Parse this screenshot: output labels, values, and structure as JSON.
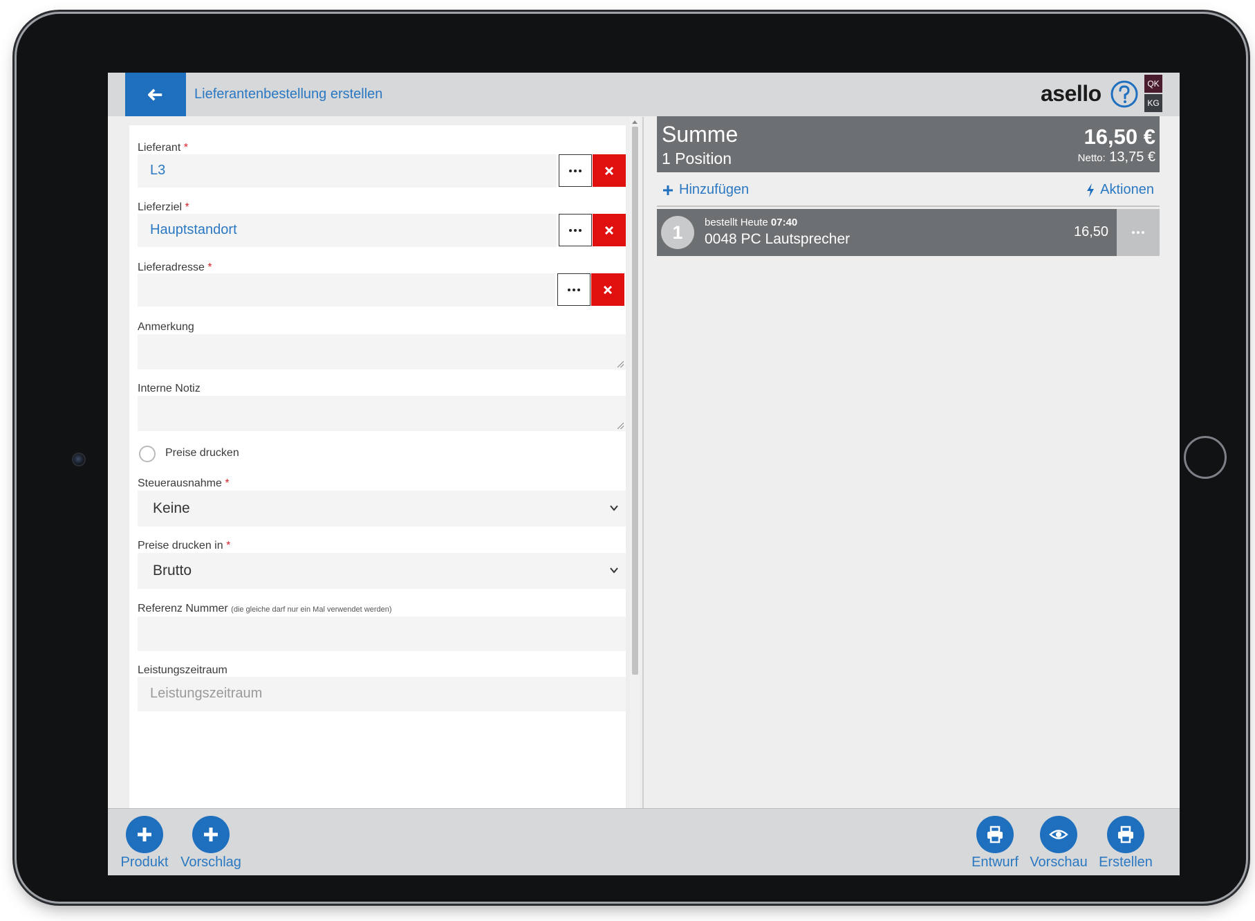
{
  "header": {
    "title": "Lieferantenbestellung erstellen",
    "brand": "asello",
    "badge_top": "QK",
    "badge_bottom": "KG"
  },
  "form": {
    "required_mark": "*",
    "supplier": {
      "label": "Lieferant",
      "value": "L3"
    },
    "destination": {
      "label": "Lieferziel",
      "value": "Hauptstandort"
    },
    "address": {
      "label": "Lieferadresse",
      "value": ""
    },
    "remark": {
      "label": "Anmerkung"
    },
    "internal_note": {
      "label": "Interne Notiz"
    },
    "print_prices": {
      "label": "Preise drucken",
      "checked": false
    },
    "tax_exemption": {
      "label": "Steuerausnahme",
      "value": "Keine"
    },
    "print_prices_in": {
      "label": "Preise drucken in",
      "value": "Brutto"
    },
    "reference": {
      "label": "Referenz Nummer",
      "hint": "(die gleiche darf nur ein Mal verwendet werden)"
    },
    "service_period": {
      "label": "Leistungszeitraum",
      "placeholder": "Leistungszeitraum"
    }
  },
  "summary": {
    "title": "Summe",
    "positions": "1 Position",
    "total": "16,50 €",
    "net_label": "Netto:",
    "net_value": "13,75 €"
  },
  "actions": {
    "add": "Hinzufügen",
    "actions": "Aktionen"
  },
  "items": [
    {
      "number": "1",
      "status": "bestellt Heute",
      "time": "07:40",
      "name": "0048 PC Lautsprecher",
      "price": "16,50"
    }
  ],
  "bottom": {
    "product": "Produkt",
    "suggestion": "Vorschlag",
    "draft": "Entwurf",
    "preview": "Vorschau",
    "create": "Erstellen"
  },
  "colors": {
    "primary": "#1f6fbf",
    "danger": "#e0100f",
    "summary_bg": "#6c7072"
  }
}
